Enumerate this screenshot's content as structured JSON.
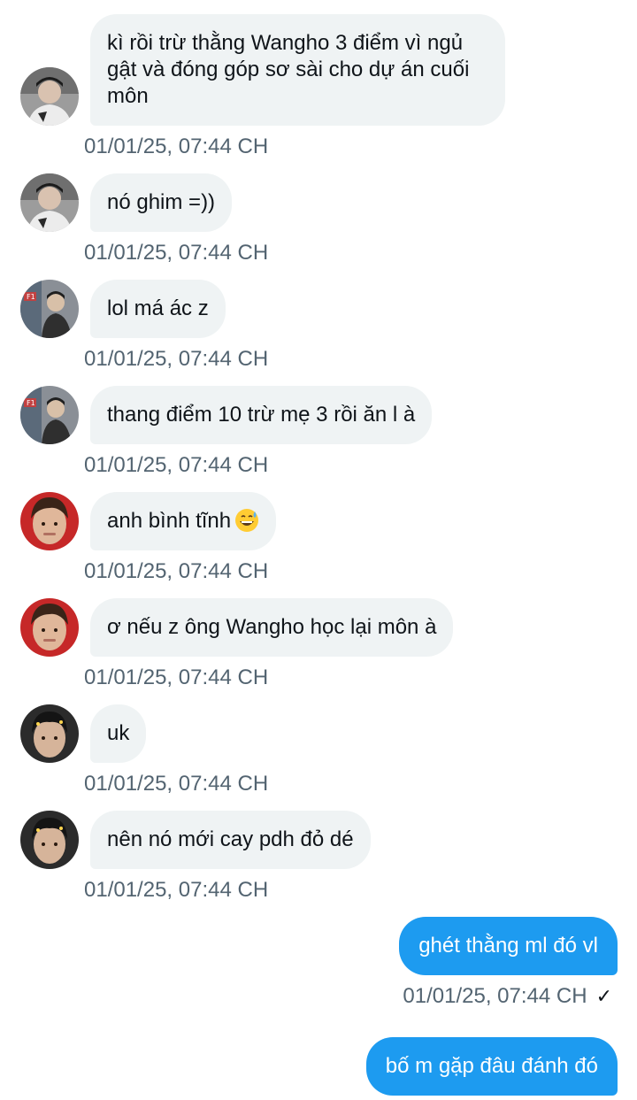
{
  "colors": {
    "incoming_bubble": "#eff3f4",
    "outgoing_bubble": "#1d9bf0",
    "timestamp": "#536471",
    "text": "#0f1419"
  },
  "messages": [
    {
      "direction": "in",
      "avatar": "avatar-user-a",
      "text": "kì rồi trừ thằng Wangho 3 điểm vì ngủ gật và đóng góp sơ sài cho dự án cuối môn",
      "time": "01/01/25, 07:44 CH"
    },
    {
      "direction": "in",
      "avatar": "avatar-user-a",
      "text": "nó ghim =))",
      "time": "01/01/25, 07:44 CH"
    },
    {
      "direction": "in",
      "avatar": "avatar-user-b",
      "text": "lol má ác z",
      "time": "01/01/25, 07:44 CH"
    },
    {
      "direction": "in",
      "avatar": "avatar-user-b",
      "text": "thang điểm 10 trừ mẹ 3 rồi ăn l à",
      "time": "01/01/25, 07:44 CH"
    },
    {
      "direction": "in",
      "avatar": "avatar-user-c",
      "text": "anh bình tĩnh",
      "emoji": "grinning-sweat-emoji",
      "time": "01/01/25, 07:44 CH"
    },
    {
      "direction": "in",
      "avatar": "avatar-user-c",
      "text": "ơ nếu z ông Wangho học lại môn à",
      "time": "01/01/25, 07:44 CH"
    },
    {
      "direction": "in",
      "avatar": "avatar-user-d",
      "text": "uk",
      "time": "01/01/25, 07:44 CH"
    },
    {
      "direction": "in",
      "avatar": "avatar-user-d",
      "text": "nên nó mới cay pdh đỏ dé",
      "time": "01/01/25, 07:44 CH"
    },
    {
      "direction": "out",
      "text": "ghét thằng ml đó vl",
      "time": "01/01/25, 07:44 CH",
      "status_icon": "sent-check-icon"
    },
    {
      "direction": "out",
      "text": "bố m gặp đâu đánh đó"
    }
  ]
}
